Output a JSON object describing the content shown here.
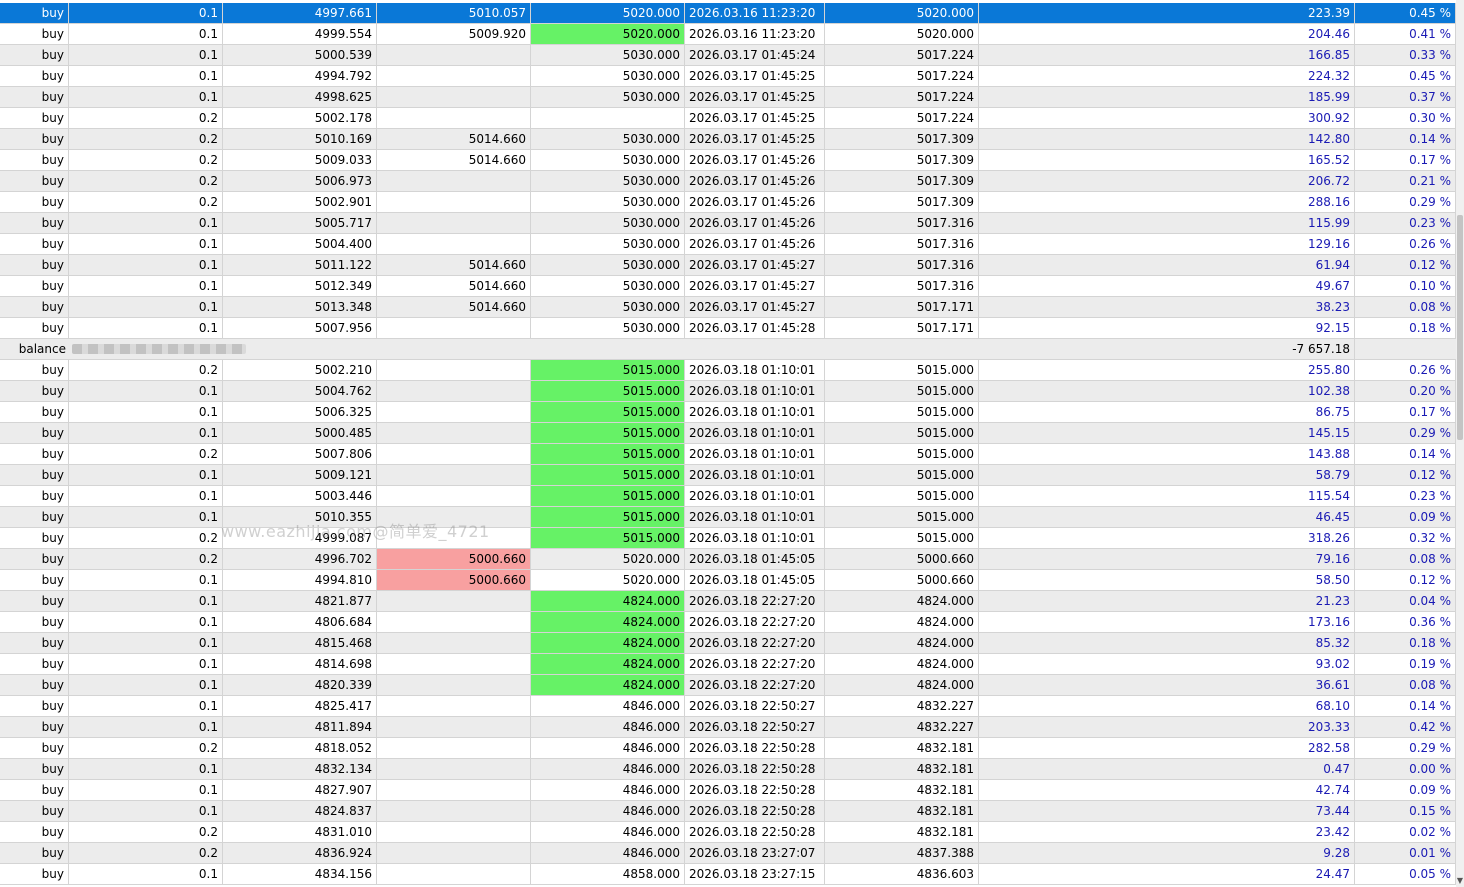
{
  "rows": [
    {
      "type": "buy",
      "volume": "0.1",
      "price": "4997.661",
      "sl": "5010.057",
      "tp": "5020.000",
      "time": "2026.03.16 11:23:20",
      "close": "5020.000",
      "profit": "223.39",
      "pct": "0.45 %",
      "tp_hit": false,
      "sl_hit": false,
      "selected": true
    },
    {
      "type": "buy",
      "volume": "0.1",
      "price": "4999.554",
      "sl": "5009.920",
      "tp": "5020.000",
      "time": "2026.03.16 11:23:20",
      "close": "5020.000",
      "profit": "204.46",
      "pct": "0.41 %",
      "tp_hit": true,
      "sl_hit": false
    },
    {
      "type": "buy",
      "volume": "0.1",
      "price": "5000.539",
      "sl": "",
      "tp": "5030.000",
      "time": "2026.03.17 01:45:24",
      "close": "5017.224",
      "profit": "166.85",
      "pct": "0.33 %"
    },
    {
      "type": "buy",
      "volume": "0.1",
      "price": "4994.792",
      "sl": "",
      "tp": "5030.000",
      "time": "2026.03.17 01:45:25",
      "close": "5017.224",
      "profit": "224.32",
      "pct": "0.45 %"
    },
    {
      "type": "buy",
      "volume": "0.1",
      "price": "4998.625",
      "sl": "",
      "tp": "5030.000",
      "time": "2026.03.17 01:45:25",
      "close": "5017.224",
      "profit": "185.99",
      "pct": "0.37 %"
    },
    {
      "type": "buy",
      "volume": "0.2",
      "price": "5002.178",
      "sl": "",
      "tp": "",
      "time": "2026.03.17 01:45:25",
      "close": "5017.224",
      "profit": "300.92",
      "pct": "0.30 %"
    },
    {
      "type": "buy",
      "volume": "0.2",
      "price": "5010.169",
      "sl": "5014.660",
      "tp": "5030.000",
      "time": "2026.03.17 01:45:25",
      "close": "5017.309",
      "profit": "142.80",
      "pct": "0.14 %"
    },
    {
      "type": "buy",
      "volume": "0.2",
      "price": "5009.033",
      "sl": "5014.660",
      "tp": "5030.000",
      "time": "2026.03.17 01:45:26",
      "close": "5017.309",
      "profit": "165.52",
      "pct": "0.17 %"
    },
    {
      "type": "buy",
      "volume": "0.2",
      "price": "5006.973",
      "sl": "",
      "tp": "5030.000",
      "time": "2026.03.17 01:45:26",
      "close": "5017.309",
      "profit": "206.72",
      "pct": "0.21 %"
    },
    {
      "type": "buy",
      "volume": "0.2",
      "price": "5002.901",
      "sl": "",
      "tp": "5030.000",
      "time": "2026.03.17 01:45:26",
      "close": "5017.309",
      "profit": "288.16",
      "pct": "0.29 %"
    },
    {
      "type": "buy",
      "volume": "0.1",
      "price": "5005.717",
      "sl": "",
      "tp": "5030.000",
      "time": "2026.03.17 01:45:26",
      "close": "5017.316",
      "profit": "115.99",
      "pct": "0.23 %"
    },
    {
      "type": "buy",
      "volume": "0.1",
      "price": "5004.400",
      "sl": "",
      "tp": "5030.000",
      "time": "2026.03.17 01:45:26",
      "close": "5017.316",
      "profit": "129.16",
      "pct": "0.26 %"
    },
    {
      "type": "buy",
      "volume": "0.1",
      "price": "5011.122",
      "sl": "5014.660",
      "tp": "5030.000",
      "time": "2026.03.17 01:45:27",
      "close": "5017.316",
      "profit": "61.94",
      "pct": "0.12 %"
    },
    {
      "type": "buy",
      "volume": "0.1",
      "price": "5012.349",
      "sl": "5014.660",
      "tp": "5030.000",
      "time": "2026.03.17 01:45:27",
      "close": "5017.316",
      "profit": "49.67",
      "pct": "0.10 %"
    },
    {
      "type": "buy",
      "volume": "0.1",
      "price": "5013.348",
      "sl": "5014.660",
      "tp": "5030.000",
      "time": "2026.03.17 01:45:27",
      "close": "5017.171",
      "profit": "38.23",
      "pct": "0.08 %"
    },
    {
      "type": "buy",
      "volume": "0.1",
      "price": "5007.956",
      "sl": "",
      "tp": "5030.000",
      "time": "2026.03.17 01:45:28",
      "close": "5017.171",
      "profit": "92.15",
      "pct": "0.18 %"
    },
    {
      "type": "balance",
      "label": "balance",
      "amount": "-7 657.18"
    },
    {
      "type": "buy",
      "volume": "0.2",
      "price": "5002.210",
      "sl": "",
      "tp": "5015.000",
      "time": "2026.03.18 01:10:01",
      "close": "5015.000",
      "profit": "255.80",
      "pct": "0.26 %",
      "tp_hit": true
    },
    {
      "type": "buy",
      "volume": "0.1",
      "price": "5004.762",
      "sl": "",
      "tp": "5015.000",
      "time": "2026.03.18 01:10:01",
      "close": "5015.000",
      "profit": "102.38",
      "pct": "0.20 %",
      "tp_hit": true
    },
    {
      "type": "buy",
      "volume": "0.1",
      "price": "5006.325",
      "sl": "",
      "tp": "5015.000",
      "time": "2026.03.18 01:10:01",
      "close": "5015.000",
      "profit": "86.75",
      "pct": "0.17 %",
      "tp_hit": true
    },
    {
      "type": "buy",
      "volume": "0.1",
      "price": "5000.485",
      "sl": "",
      "tp": "5015.000",
      "time": "2026.03.18 01:10:01",
      "close": "5015.000",
      "profit": "145.15",
      "pct": "0.29 %",
      "tp_hit": true
    },
    {
      "type": "buy",
      "volume": "0.2",
      "price": "5007.806",
      "sl": "",
      "tp": "5015.000",
      "time": "2026.03.18 01:10:01",
      "close": "5015.000",
      "profit": "143.88",
      "pct": "0.14 %",
      "tp_hit": true
    },
    {
      "type": "buy",
      "volume": "0.1",
      "price": "5009.121",
      "sl": "",
      "tp": "5015.000",
      "time": "2026.03.18 01:10:01",
      "close": "5015.000",
      "profit": "58.79",
      "pct": "0.12 %",
      "tp_hit": true
    },
    {
      "type": "buy",
      "volume": "0.1",
      "price": "5003.446",
      "sl": "",
      "tp": "5015.000",
      "time": "2026.03.18 01:10:01",
      "close": "5015.000",
      "profit": "115.54",
      "pct": "0.23 %",
      "tp_hit": true
    },
    {
      "type": "buy",
      "volume": "0.1",
      "price": "5010.355",
      "sl": "",
      "tp": "5015.000",
      "time": "2026.03.18 01:10:01",
      "close": "5015.000",
      "profit": "46.45",
      "pct": "0.09 %",
      "tp_hit": true
    },
    {
      "type": "buy",
      "volume": "0.2",
      "price": "4999.087",
      "sl": "",
      "tp": "5015.000",
      "time": "2026.03.18 01:10:01",
      "close": "5015.000",
      "profit": "318.26",
      "pct": "0.32 %",
      "tp_hit": true
    },
    {
      "type": "buy",
      "volume": "0.2",
      "price": "4996.702",
      "sl": "5000.660",
      "tp": "5020.000",
      "time": "2026.03.18 01:45:05",
      "close": "5000.660",
      "profit": "79.16",
      "pct": "0.08 %",
      "sl_hit": true
    },
    {
      "type": "buy",
      "volume": "0.1",
      "price": "4994.810",
      "sl": "5000.660",
      "tp": "5020.000",
      "time": "2026.03.18 01:45:05",
      "close": "5000.660",
      "profit": "58.50",
      "pct": "0.12 %",
      "sl_hit": true
    },
    {
      "type": "buy",
      "volume": "0.1",
      "price": "4821.877",
      "sl": "",
      "tp": "4824.000",
      "time": "2026.03.18 22:27:20",
      "close": "4824.000",
      "profit": "21.23",
      "pct": "0.04 %",
      "tp_hit": true
    },
    {
      "type": "buy",
      "volume": "0.1",
      "price": "4806.684",
      "sl": "",
      "tp": "4824.000",
      "time": "2026.03.18 22:27:20",
      "close": "4824.000",
      "profit": "173.16",
      "pct": "0.36 %",
      "tp_hit": true
    },
    {
      "type": "buy",
      "volume": "0.1",
      "price": "4815.468",
      "sl": "",
      "tp": "4824.000",
      "time": "2026.03.18 22:27:20",
      "close": "4824.000",
      "profit": "85.32",
      "pct": "0.18 %",
      "tp_hit": true
    },
    {
      "type": "buy",
      "volume": "0.1",
      "price": "4814.698",
      "sl": "",
      "tp": "4824.000",
      "time": "2026.03.18 22:27:20",
      "close": "4824.000",
      "profit": "93.02",
      "pct": "0.19 %",
      "tp_hit": true
    },
    {
      "type": "buy",
      "volume": "0.1",
      "price": "4820.339",
      "sl": "",
      "tp": "4824.000",
      "time": "2026.03.18 22:27:20",
      "close": "4824.000",
      "profit": "36.61",
      "pct": "0.08 %",
      "tp_hit": true
    },
    {
      "type": "buy",
      "volume": "0.1",
      "price": "4825.417",
      "sl": "",
      "tp": "4846.000",
      "time": "2026.03.18 22:50:27",
      "close": "4832.227",
      "profit": "68.10",
      "pct": "0.14 %"
    },
    {
      "type": "buy",
      "volume": "0.1",
      "price": "4811.894",
      "sl": "",
      "tp": "4846.000",
      "time": "2026.03.18 22:50:27",
      "close": "4832.227",
      "profit": "203.33",
      "pct": "0.42 %"
    },
    {
      "type": "buy",
      "volume": "0.2",
      "price": "4818.052",
      "sl": "",
      "tp": "4846.000",
      "time": "2026.03.18 22:50:28",
      "close": "4832.181",
      "profit": "282.58",
      "pct": "0.29 %"
    },
    {
      "type": "buy",
      "volume": "0.1",
      "price": "4832.134",
      "sl": "",
      "tp": "4846.000",
      "time": "2026.03.18 22:50:28",
      "close": "4832.181",
      "profit": "0.47",
      "pct": "0.00 %"
    },
    {
      "type": "buy",
      "volume": "0.1",
      "price": "4827.907",
      "sl": "",
      "tp": "4846.000",
      "time": "2026.03.18 22:50:28",
      "close": "4832.181",
      "profit": "42.74",
      "pct": "0.09 %"
    },
    {
      "type": "buy",
      "volume": "0.1",
      "price": "4824.837",
      "sl": "",
      "tp": "4846.000",
      "time": "2026.03.18 22:50:28",
      "close": "4832.181",
      "profit": "73.44",
      "pct": "0.15 %"
    },
    {
      "type": "buy",
      "volume": "0.2",
      "price": "4831.010",
      "sl": "",
      "tp": "4846.000",
      "time": "2026.03.18 22:50:28",
      "close": "4832.181",
      "profit": "23.42",
      "pct": "0.02 %"
    },
    {
      "type": "buy",
      "volume": "0.2",
      "price": "4836.924",
      "sl": "",
      "tp": "4846.000",
      "time": "2026.03.18 23:27:07",
      "close": "4837.388",
      "profit": "9.28",
      "pct": "0.01 %"
    },
    {
      "type": "buy",
      "volume": "0.1",
      "price": "4834.156",
      "sl": "",
      "tp": "4858.000",
      "time": "2026.03.18 23:27:15",
      "close": "4836.603",
      "profit": "24.47",
      "pct": "0.05 %"
    }
  ],
  "watermark": "www.eazhijia.com@简单爱_4721",
  "colors": {
    "selected": "#0a78d7",
    "tp_hit": "#66f266",
    "sl_hit": "#f8a0a0",
    "profit_text": "#1a1ab4",
    "row_alt": "#ececec"
  }
}
